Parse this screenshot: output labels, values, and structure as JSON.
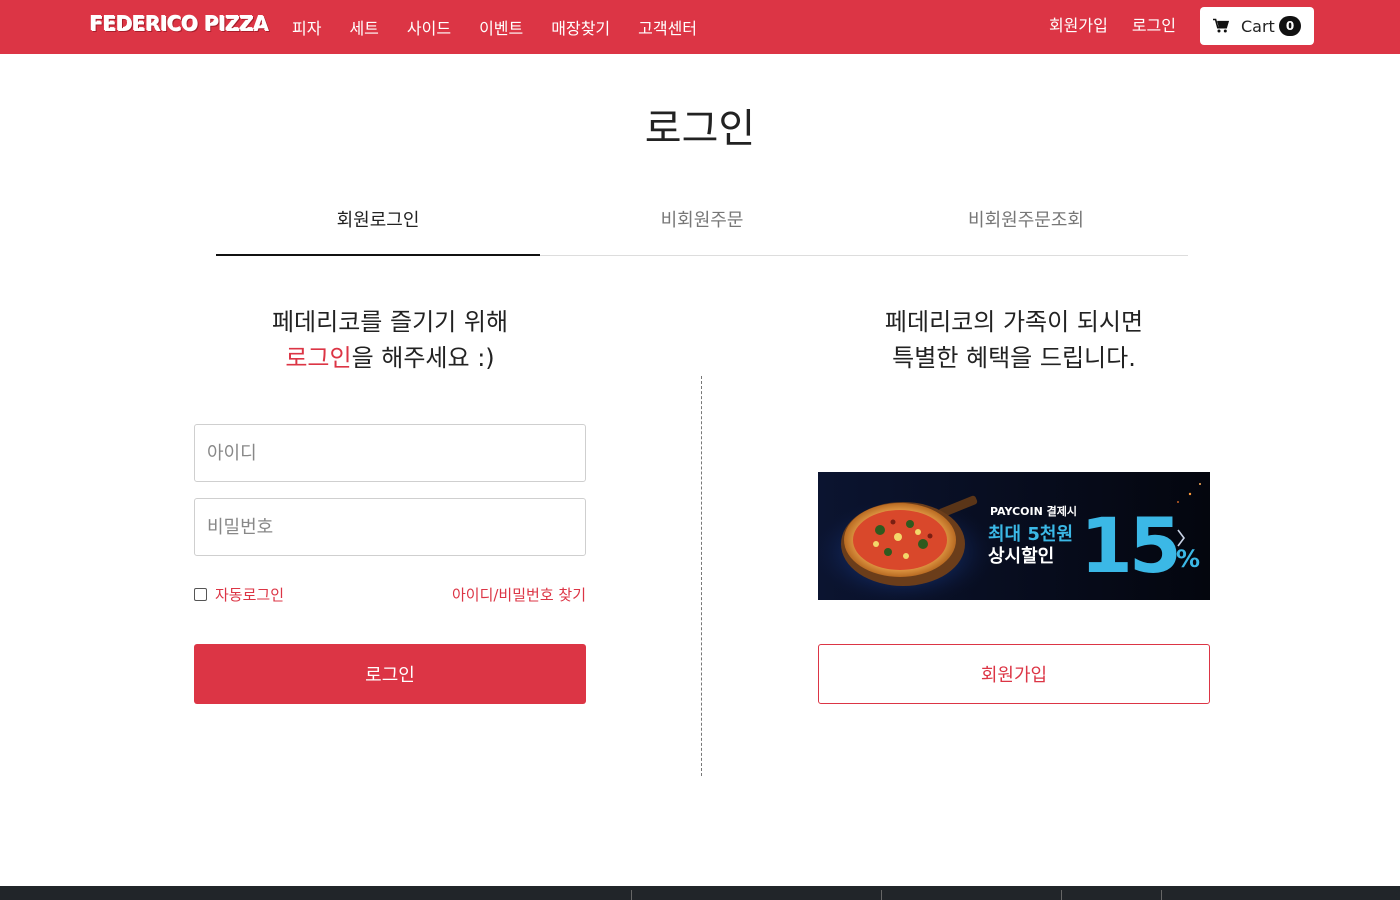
{
  "navbar": {
    "brand": "FEDERICO PIZZA",
    "links": [
      "피자",
      "세트",
      "사이드",
      "이벤트",
      "매장찾기",
      "고객센터"
    ],
    "signup": "회원가입",
    "login": "로그인",
    "cart_label": "Cart",
    "cart_count": "0"
  },
  "page_title": "로그인",
  "tabs": [
    "회원로그인",
    "비회원주문",
    "비회원주문조회"
  ],
  "left": {
    "heading_line1": "페데리코를 즐기기 위해",
    "heading_accent": "로그인",
    "heading_line2_rest": "을 해주세요 :)",
    "id_placeholder": "아이디",
    "pw_placeholder": "비밀번호",
    "auto_login": "자동로그인",
    "find_account": "아이디/비밀번호 찾기",
    "login_button": "로그인"
  },
  "right": {
    "heading_line1": "페데리코의 가족이 되시면",
    "heading_line2": "특별한 혜택을 드립니다.",
    "banner": {
      "line1": "PAYCOIN 결제시",
      "line2": "최대 5천원",
      "line3": "상시할인",
      "percent": "15",
      "percent_sign": "%"
    },
    "signup_button": "회원가입"
  },
  "colors": {
    "accent": "#dc3545",
    "banner_blue": "#3bb8e6",
    "footer": "#212529"
  }
}
